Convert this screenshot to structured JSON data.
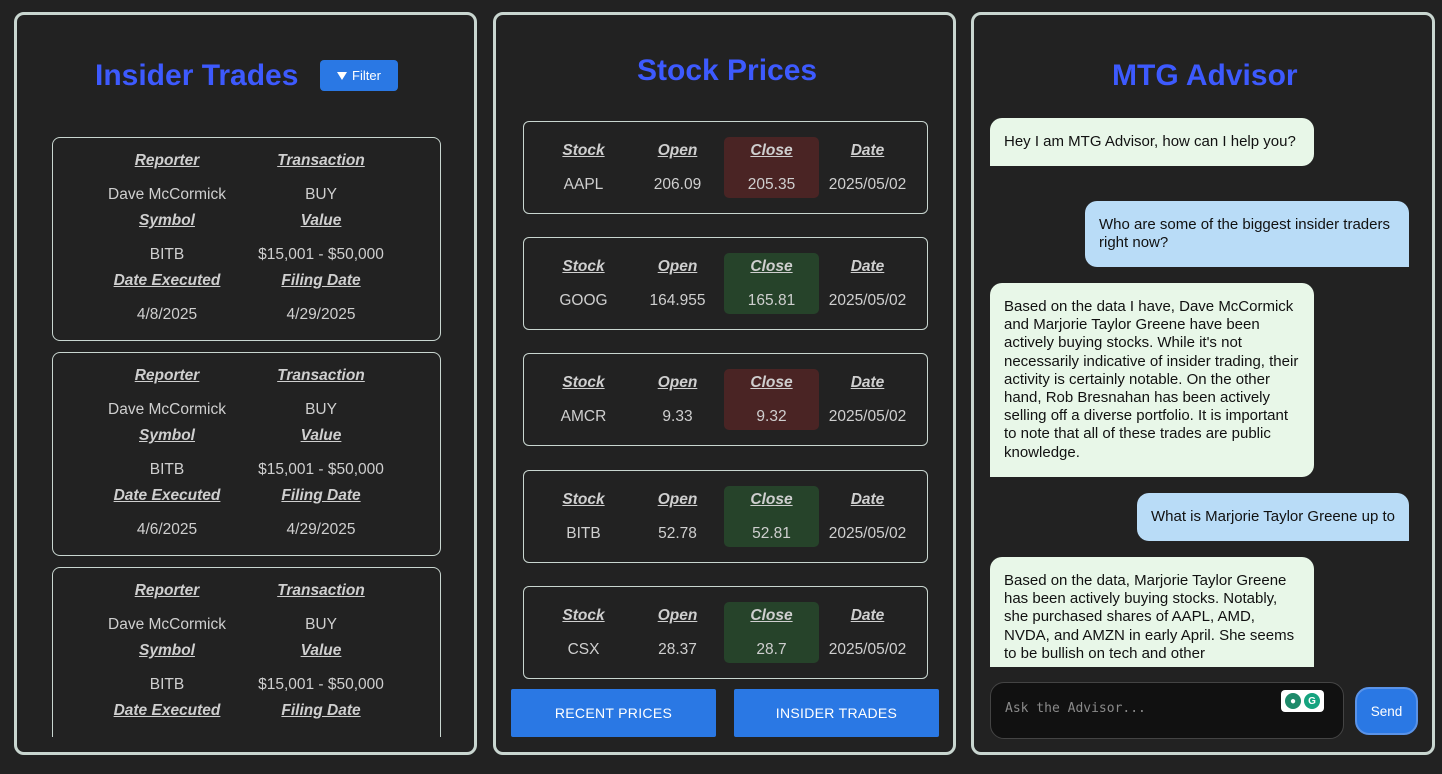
{
  "insider": {
    "title": "Insider Trades",
    "filter_label": "Filter",
    "headers": {
      "reporter": "Reporter",
      "transaction": "Transaction",
      "symbol": "Symbol",
      "value": "Value",
      "date_executed": "Date Executed",
      "filing_date": "Filing Date"
    },
    "trades": [
      {
        "reporter": "Dave McCormick",
        "transaction": "BUY",
        "symbol": "BITB",
        "value": "$15,001 - $50,000",
        "date_executed": "4/8/2025",
        "filing_date": "4/29/2025"
      },
      {
        "reporter": "Dave McCormick",
        "transaction": "BUY",
        "symbol": "BITB",
        "value": "$15,001 - $50,000",
        "date_executed": "4/6/2025",
        "filing_date": "4/29/2025"
      },
      {
        "reporter": "Dave McCormick",
        "transaction": "BUY",
        "symbol": "BITB",
        "value": "$15,001 - $50,000",
        "date_executed": "",
        "filing_date": ""
      }
    ]
  },
  "stocks": {
    "title": "Stock Prices",
    "headers": {
      "stock": "Stock",
      "open": "Open",
      "close": "Close",
      "date": "Date"
    },
    "rows": [
      {
        "stock": "AAPL",
        "open": "206.09",
        "close": "205.35",
        "date": "2025/05/02",
        "direction": "down"
      },
      {
        "stock": "GOOG",
        "open": "164.955",
        "close": "165.81",
        "date": "2025/05/02",
        "direction": "up"
      },
      {
        "stock": "AMCR",
        "open": "9.33",
        "close": "9.32",
        "date": "2025/05/02",
        "direction": "down"
      },
      {
        "stock": "BITB",
        "open": "52.78",
        "close": "52.81",
        "date": "2025/05/02",
        "direction": "up"
      },
      {
        "stock": "CSX",
        "open": "28.37",
        "close": "28.7",
        "date": "2025/05/02",
        "direction": "up"
      }
    ],
    "recent_prices_label": "RECENT PRICES",
    "insider_trades_label": "INSIDER TRADES"
  },
  "advisor": {
    "title": "MTG Advisor",
    "messages": [
      {
        "role": "bot",
        "text": "Hey I am MTG Advisor, how can I help you?"
      },
      {
        "role": "user",
        "text": "Who are some of the biggest insider traders right now?"
      },
      {
        "role": "bot",
        "text": "Based on the data I have, Dave McCormick and Marjorie Taylor Greene have been actively buying stocks. While it's not necessarily indicative of insider trading, their activity is certainly notable. On the other hand, Rob Bresnahan has been actively selling off a diverse portfolio. It is important to note that all of these trades are public knowledge."
      },
      {
        "role": "user",
        "text": "What is Marjorie Taylor Greene up to"
      },
      {
        "role": "bot",
        "text": "Based on the data, Marjorie Taylor Greene has been actively buying stocks. Notably, she purchased shares of AAPL, AMD, NVDA, and AMZN in early April. She seems to be bullish on tech and other"
      }
    ],
    "input_placeholder": "Ask the Advisor...",
    "send_label": "Send"
  },
  "colors": {
    "accent": "#3d5afe",
    "button": "#2a78e4",
    "close_down": "#4a2424",
    "close_up": "#26432a",
    "bot_bubble": "#e8f7e8",
    "user_bubble": "#b9dcf7"
  }
}
